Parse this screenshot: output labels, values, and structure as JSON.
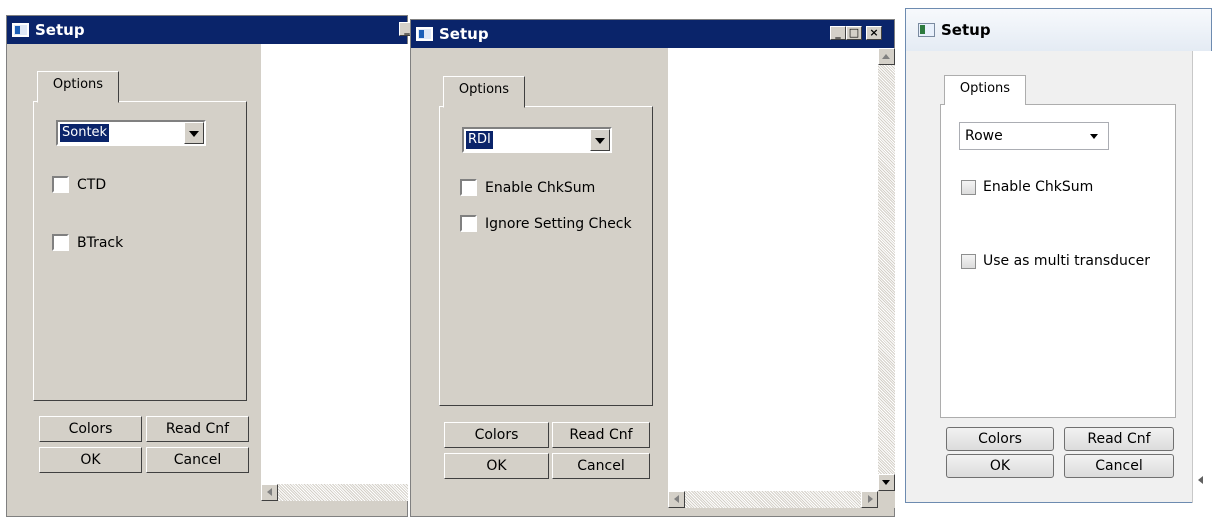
{
  "windows": [
    {
      "title": "Setup",
      "tab_label": "Options",
      "device": {
        "selected": "Sontek"
      },
      "checkboxes": [
        {
          "label": "CTD"
        },
        {
          "label": "BTrack"
        }
      ],
      "buttons": {
        "colors": "Colors",
        "read_cnf": "Read Cnf",
        "ok": "OK",
        "cancel": "Cancel"
      }
    },
    {
      "title": "Setup",
      "tab_label": "Options",
      "device": {
        "selected": "RDI"
      },
      "checkboxes": [
        {
          "label": "Enable ChkSum"
        },
        {
          "label": "Ignore Setting Check"
        }
      ],
      "buttons": {
        "colors": "Colors",
        "read_cnf": "Read Cnf",
        "ok": "OK",
        "cancel": "Cancel"
      }
    },
    {
      "title": "Setup",
      "tab_label": "Options",
      "device": {
        "selected": "Rowe"
      },
      "checkboxes": [
        {
          "label": "Enable ChkSum"
        },
        {
          "label": "Use as multi transducer"
        }
      ],
      "buttons": {
        "colors": "Colors",
        "read_cnf": "Read Cnf",
        "ok": "OK",
        "cancel": "Cancel"
      }
    }
  ],
  "icons": {
    "app": "app-window-icon",
    "minimize": "minimize-icon",
    "maximize": "maximize-icon",
    "close": "close-icon",
    "scroll_up": "scroll-up-arrow-icon",
    "scroll_down": "scroll-down-arrow-icon",
    "scroll_left": "scroll-left-arrow-icon",
    "scroll_right": "scroll-right-arrow-icon",
    "dropdown": "dropdown-arrow-icon"
  },
  "colors": {
    "classic_titlebar": "#0a246a",
    "face": "#d4d0c8",
    "selection": "#0a246a"
  }
}
